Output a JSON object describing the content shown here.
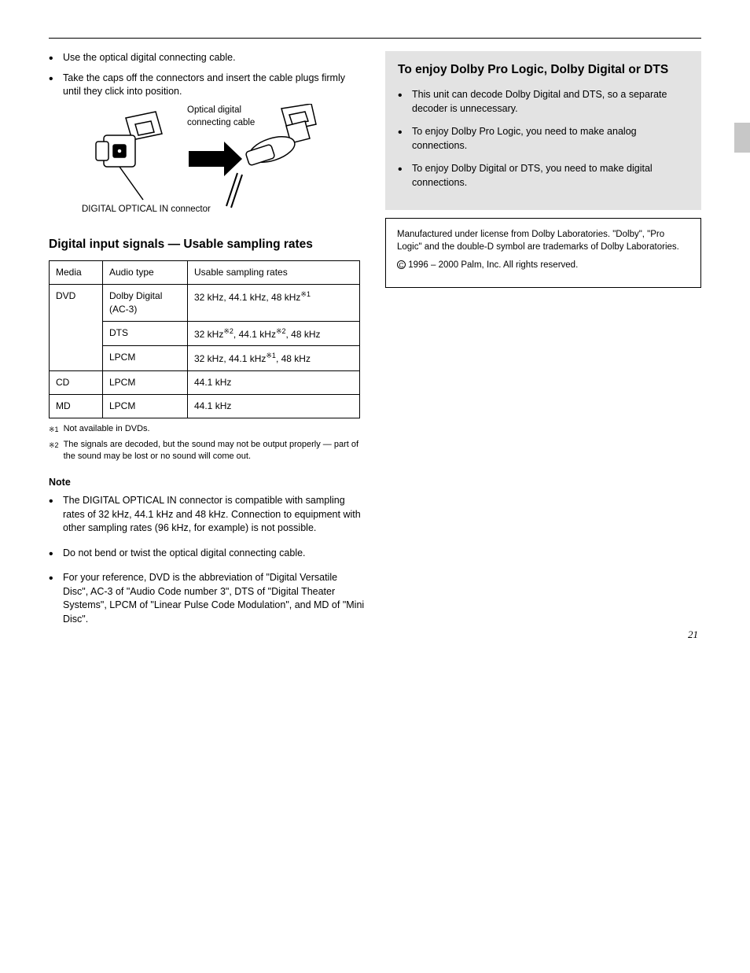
{
  "leftColumn": {
    "bullet1": "Use the optical digital connecting cable.",
    "bullet2": "Take the caps off the connectors and insert the cable plugs firmly until they click into position.",
    "illusLabel1": "DIGITAL OPTICAL IN connector",
    "illusLabel2": "Optical digital connecting cable",
    "samplingTitle": "Digital input signals — Usable sampling rates",
    "table": {
      "headers": [
        "Media",
        "Audio type",
        "Usable sampling rates"
      ],
      "rows": [
        [
          {
            "text": "DVD",
            "rowspan": 3
          },
          {
            "text": "Dolby Digital (AC-3)"
          },
          {
            "text": "32 kHz, 44.1 kHz, 48 kHz",
            "sup": "1"
          }
        ],
        [
          {
            "text": "DTS"
          },
          {
            "text": "32 kHz",
            "sup": "2",
            "extra": ", 44.1 kHz",
            "extra_sup": "2",
            "extra2": ", 48 kHz"
          }
        ],
        [
          {
            "text": "LPCM"
          },
          {
            "text": "32 kHz, 44.1 kHz",
            "sup": "1",
            "extra": ", 48 kHz"
          }
        ],
        [
          {
            "text": "CD"
          },
          {
            "text": "LPCM"
          },
          {
            "text": "44.1 kHz"
          }
        ],
        [
          {
            "text": "MD"
          },
          {
            "text": "LPCM"
          },
          {
            "text": "44.1 kHz"
          }
        ]
      ]
    },
    "fn1_mark": "1",
    "fn1_text": "Not available in DVDs.",
    "fn2_mark": "2",
    "fn2_text": "The signals are decoded, but the sound may not be output properly — part of the sound may be lost or no sound will come out.",
    "noteTitle": "Note",
    "notes": [
      "The DIGITAL OPTICAL IN connector is compatible with sampling rates of 32 kHz, 44.1 kHz and 48 kHz. Connection to equipment with other sampling rates (96 kHz, for example) is not possible.",
      "Do not bend or twist the optical digital connecting cable.",
      "For your reference, DVD is the abbreviation of \"Digital Versatile Disc\", AC-3 of \"Audio Code number 3\", DTS of \"Digital Theater Systems\", LPCM of \"Linear Pulse Code Modulation\", and MD of \"Mini Disc\"."
    ]
  },
  "rightColumn": {
    "title": "To enjoy Dolby Pro Logic, Dolby Digital or DTS",
    "bullets": [
      "This unit can decode Dolby Digital and DTS, so a separate decoder is unnecessary.",
      "To enjoy Dolby Pro Logic, you need to make analog connections.",
      "To enjoy Dolby Digital or DTS, you need to make digital connections."
    ],
    "boxText": "Manufactured under license from Dolby Laboratories. \"Dolby\", \"Pro Logic\" and the double-D symbol are trademarks of Dolby Laboratories.",
    "copyrightLine": "1996 – 2000 Palm, Inc. All rights reserved."
  },
  "pageNumber": "21"
}
